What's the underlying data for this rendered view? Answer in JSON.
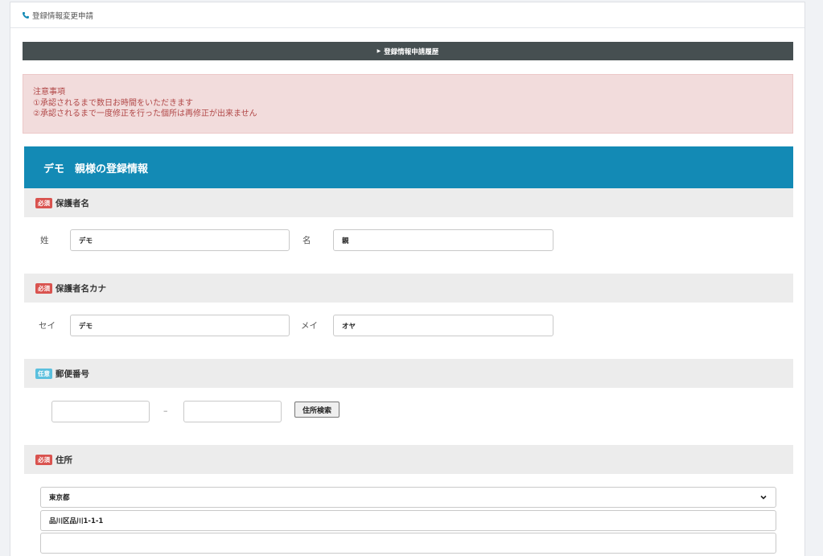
{
  "header": {
    "title": "登録情報変更申請"
  },
  "history": {
    "label": "登録情報申請履歴"
  },
  "notice": {
    "title": "注意事項",
    "line1": "①承認されるまで数日お時間をいただきます",
    "line2": "②承認されるまで一度修正を行った個所は再修正が出来ません"
  },
  "section": {
    "title": "デモ　親様の登録情報"
  },
  "badges": {
    "required": "必須",
    "optional": "任意"
  },
  "guardian_name": {
    "label": "保護者名",
    "last_label": "姓",
    "last_value": "デモ",
    "first_label": "名",
    "first_value": "親"
  },
  "guardian_kana": {
    "label": "保護者名カナ",
    "last_label": "セイ",
    "last_value": "デモ",
    "first_label": "メイ",
    "first_value": "オヤ"
  },
  "postal": {
    "label": "郵便番号",
    "part1": "",
    "part2": "",
    "separator": "–",
    "search_label": "住所検索"
  },
  "address": {
    "label": "住所",
    "prefecture": "東京都",
    "line1": "品川区品川1-1-1",
    "line2": ""
  },
  "colors": {
    "accent": "#138ab5",
    "required": "#d9534f",
    "optional": "#5bc0de",
    "notice": "#b14848"
  }
}
